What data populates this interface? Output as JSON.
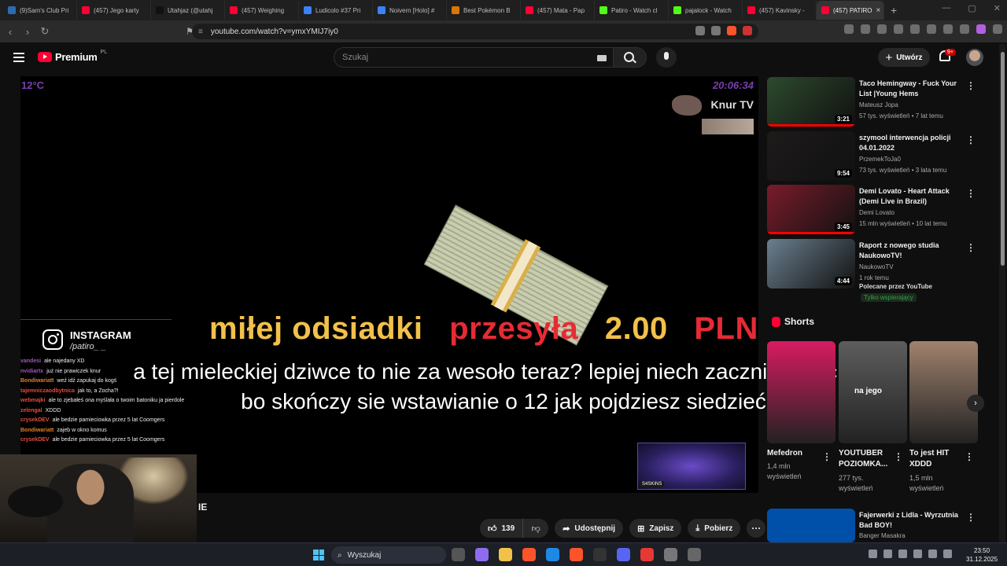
{
  "browser": {
    "tabs": [
      {
        "label": "(9)Sam's Club Pri",
        "color": "#2b6cb0"
      },
      {
        "label": "(457) Jego karty",
        "color": "#ff0033"
      },
      {
        "label": "Utahjaz (@utahj",
        "color": "#111111"
      },
      {
        "label": "(457) Weighing",
        "color": "#ff0033"
      },
      {
        "label": "Ludicolo #37 Pri",
        "color": "#3b82f6"
      },
      {
        "label": "Noivern [Holo] #",
        "color": "#3b82f6"
      },
      {
        "label": "Best Pokémon B",
        "color": "#d97706"
      },
      {
        "label": "(457) Mata - Pap",
        "color": "#ff0033"
      },
      {
        "label": "Patiro - Watch cl",
        "color": "#53fc18"
      },
      {
        "label": "pajalock - Watch",
        "color": "#53fc18"
      },
      {
        "label": "(457) Kavinsky -",
        "color": "#ff0033"
      }
    ],
    "active_tab": {
      "label": "(457) PATIRO",
      "color": "#ff0033"
    },
    "url": "youtube.com/watch?v=ymxYMIJ7iy0"
  },
  "youtube": {
    "logo_word": "Premium",
    "logo_region": "PL",
    "search_placeholder": "Szukaj",
    "create_label": "Utwórz",
    "notifications_badge": "9+"
  },
  "video": {
    "temperature": "12°C",
    "clock": "20:06:34",
    "channel_overlay": "Knur TV",
    "donation": {
      "message": "miłej odsiadki",
      "verb": "przesyła",
      "amount": "2.00",
      "currency": "PLN"
    },
    "tts_text": "a tej mieleckiej dziwce to nie za wesoło teraz? lepiej niech zacznie pisać CV bo skończy sie wstawianie o 12 jak pojdziesz siedzieć",
    "instagram": {
      "label": "INSTAGRAM",
      "handle": "/patiro_ _"
    },
    "chat": [
      {
        "user": "vandesi",
        "msg": "ale najedany XD",
        "color": "#9b59b6"
      },
      {
        "user": "nvidiartx",
        "msg": "już nie prawiczek knur",
        "color": "#9b59b6"
      },
      {
        "user": "Bondiwariatt",
        "msg": "weź idź zapukaj do kogś",
        "color": "#e67e22"
      },
      {
        "user": "tajemniczaodbytnica",
        "msg": "jak to, a Zocha?!",
        "color": "#e74c3c"
      },
      {
        "user": "webmajki",
        "msg": "ale to zjebałeś ona myślała o twoim batoniku ja pierdole",
        "color": "#e74c3c"
      },
      {
        "user": "zelengal",
        "msg": "XDDD",
        "color": "#e74c3c"
      },
      {
        "user": "crysekDEV",
        "msg": "ale bedzie pamieciowka przez 5 lat Coomgers",
        "color": "#e74c3c"
      },
      {
        "user": "Bondiwariatt",
        "msg": "zajeb w okno komus",
        "color": "#e67e22"
      },
      {
        "user": "crysekDEV",
        "msg": "ale bedzie pamieciowka przez 5 lat Coomgers",
        "color": "#e74c3c"
      }
    ],
    "side_text": "IE",
    "skins_tag": "S4SKINS"
  },
  "actions": {
    "likes": "139",
    "share_label": "Udostępnij",
    "save_label": "Zapisz",
    "download_label": "Pobierz"
  },
  "recommendations": [
    {
      "title": "Taco Hemingway - Fuck Your List |Young Hems",
      "channel": "Mateusz Jopa",
      "stats": "57 tys. wyświetleń • 7 lat temu",
      "duration": "3:21",
      "progress": 1.0,
      "thumb": "#2d4a2e"
    },
    {
      "title": "szymool interwencja policji 04.01.2022",
      "channel": "PrzemekToJa0",
      "stats": "73 tys. wyświetleń • 3 lata temu",
      "duration": "9:54",
      "progress": 0,
      "thumb": "#1d1a1a"
    },
    {
      "title": "Demi Lovato - Heart Attack (Demi Live in Brazil)",
      "channel": "Demi Lovato",
      "stats": "15 mln wyświetleń • 10 lat temu",
      "duration": "3:45",
      "progress": 1.0,
      "thumb": "#7a1c2a"
    },
    {
      "title": "Raport z nowego studia NaukowoTV!",
      "channel": "NaukowoTV",
      "stats": "1 rok temu",
      "duration": "4:44",
      "progress": 0,
      "thumb": "#6b7f8f",
      "extra": "Polecane przez YouTube",
      "members": "Tylko wspierający"
    }
  ],
  "shorts": {
    "heading": "Shorts",
    "items": [
      {
        "title": "Mefedron",
        "views": "1,4 mln wyświetleń",
        "thumb": "#d81b60"
      },
      {
        "title": "YOUTUBER POZIOMKA...",
        "views": "277 tys. wyświetleń",
        "thumb": "#5d5d5d",
        "overlay": "na jego"
      },
      {
        "title": "To jest HIT XDDD",
        "views": "1,5 mln wyświetleń",
        "thumb": "#a0826d"
      }
    ]
  },
  "next_rec": {
    "title": "Fajerwerki z Lidla - Wyrzutnia Bad BOY!",
    "channel": "Banger Masakra",
    "thumb": "#0050aa"
  },
  "taskbar": {
    "search_placeholder": "Wyszukaj",
    "time": "23:50",
    "date": "31.12.2025"
  }
}
